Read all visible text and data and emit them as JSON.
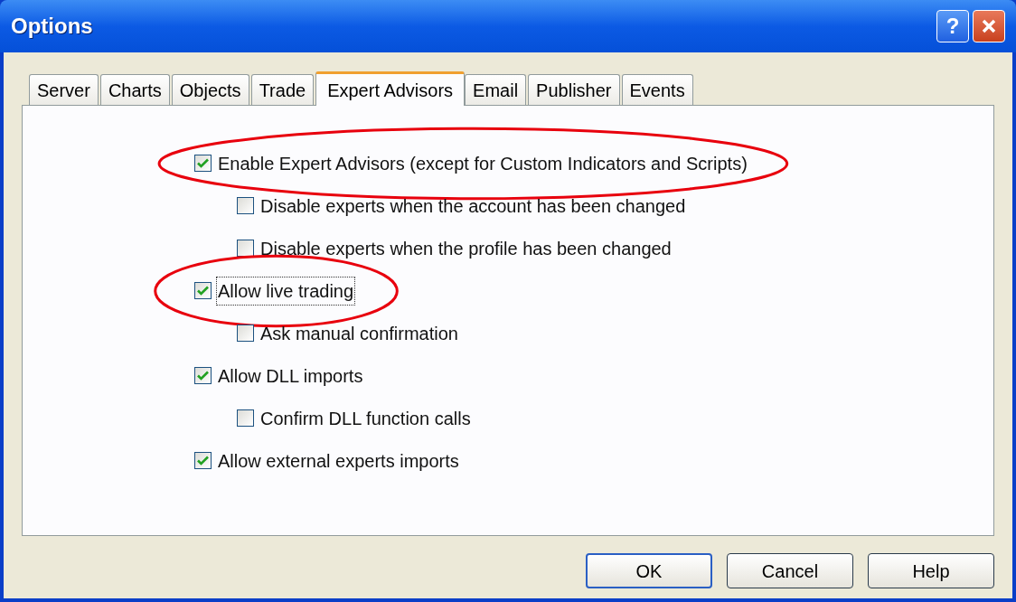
{
  "window": {
    "title": "Options",
    "help_button": "?"
  },
  "tabs": [
    {
      "label": "Server",
      "selected": false
    },
    {
      "label": "Charts",
      "selected": false
    },
    {
      "label": "Objects",
      "selected": false
    },
    {
      "label": "Trade",
      "selected": false
    },
    {
      "label": "Expert Advisors",
      "selected": true
    },
    {
      "label": "Email",
      "selected": false
    },
    {
      "label": "Publisher",
      "selected": false
    },
    {
      "label": "Events",
      "selected": false
    }
  ],
  "options": [
    {
      "label": "Enable Expert Advisors (except for Custom Indicators and Scripts)",
      "checked": true,
      "focused": false,
      "circled": true,
      "children": [
        {
          "label": "Disable experts when the account has been changed",
          "checked": false,
          "focused": false,
          "circled": false
        },
        {
          "label": "Disable experts when the profile has been changed",
          "checked": false,
          "focused": false,
          "circled": false
        }
      ]
    },
    {
      "label": "Allow live trading",
      "checked": true,
      "focused": true,
      "circled": true,
      "children": [
        {
          "label": "Ask manual confirmation",
          "checked": false,
          "focused": false,
          "circled": false
        }
      ]
    },
    {
      "label": "Allow DLL imports",
      "checked": true,
      "focused": false,
      "circled": false,
      "children": [
        {
          "label": "Confirm DLL function calls",
          "checked": false,
          "focused": false,
          "circled": false
        }
      ]
    },
    {
      "label": "Allow external experts imports",
      "checked": true,
      "focused": false,
      "circled": false
    }
  ],
  "buttons": [
    {
      "label": "OK",
      "default": true
    },
    {
      "label": "Cancel",
      "default": false
    },
    {
      "label": "Help",
      "default": false
    }
  ]
}
